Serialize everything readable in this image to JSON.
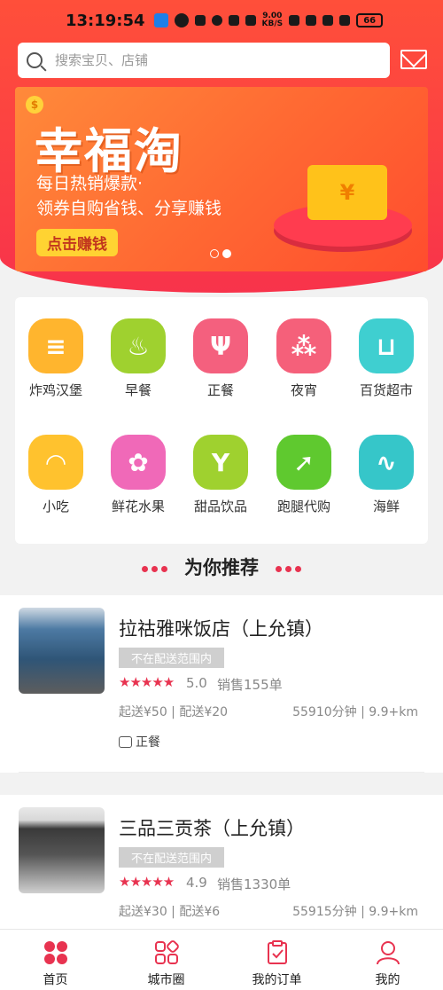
{
  "status": {
    "time": "13:19:54",
    "net_speed": "9.00\nKB/S",
    "battery": "66"
  },
  "search": {
    "placeholder": "搜索宝贝、店铺"
  },
  "banner": {
    "title": "幸福淘",
    "line1": "每日热销爆款·",
    "line2": "领券自购省钱、分享赚钱",
    "cta": "点击赚钱",
    "coin": "$",
    "wallet_symbol": "¥"
  },
  "categories": [
    {
      "label": "炸鸡汉堡",
      "icon": "burger-icon",
      "glyph": "≡",
      "color": "#ffb52e"
    },
    {
      "label": "早餐",
      "icon": "noodle-bowl-icon",
      "glyph": "♨",
      "color": "#9fd12f"
    },
    {
      "label": "正餐",
      "icon": "fork-knife-icon",
      "glyph": "Ψ",
      "color": "#f4607e"
    },
    {
      "label": "夜宵",
      "icon": "skewer-icon",
      "glyph": "⁂",
      "color": "#f5607a"
    },
    {
      "label": "百货超市",
      "icon": "cart-icon",
      "glyph": "⊔",
      "color": "#3fcfd0"
    },
    {
      "label": "小吃",
      "icon": "dumpling-icon",
      "glyph": "◠",
      "color": "#ffc22e"
    },
    {
      "label": "鲜花水果",
      "icon": "rose-icon",
      "glyph": "✿",
      "color": "#f069b8"
    },
    {
      "label": "甜品饮品",
      "icon": "cocktail-icon",
      "glyph": "Y",
      "color": "#9fd12f"
    },
    {
      "label": "跑腿代购",
      "icon": "runner-icon",
      "glyph": "➚",
      "color": "#5fc92f"
    },
    {
      "label": "海鲜",
      "icon": "shrimp-icon",
      "glyph": "∿",
      "color": "#36c6c9"
    }
  ],
  "recommend": {
    "title": "为你推荐"
  },
  "shops": [
    {
      "name": "拉祜雅咪饭店（上允镇）",
      "tag": "不在配送范围内",
      "stars": "★★★★★",
      "score": "5.0",
      "sales": "销售155单",
      "fee": "起送¥50 | 配送¥20",
      "dist": "55910分钟 | 9.9+km",
      "type": "正餐",
      "img_color": "#3d6f9c"
    },
    {
      "name": "三品三贡茶（上允镇）",
      "tag": "不在配送范围内",
      "stars": "★★★★★",
      "score": "4.9",
      "sales": "销售1330单",
      "fee": "起送¥30 | 配送¥6",
      "dist": "55915分钟 | 9.9+km",
      "img_color": "#8a8a8a"
    }
  ],
  "tabs": [
    {
      "label": "首页",
      "icon": "home-grid-icon",
      "active": true
    },
    {
      "label": "城市圈",
      "icon": "city-circle-icon"
    },
    {
      "label": "我的订单",
      "icon": "order-clipboard-icon"
    },
    {
      "label": "我的",
      "icon": "profile-icon"
    }
  ],
  "colors": {
    "accent": "#e83350",
    "header": "#f8334b"
  }
}
